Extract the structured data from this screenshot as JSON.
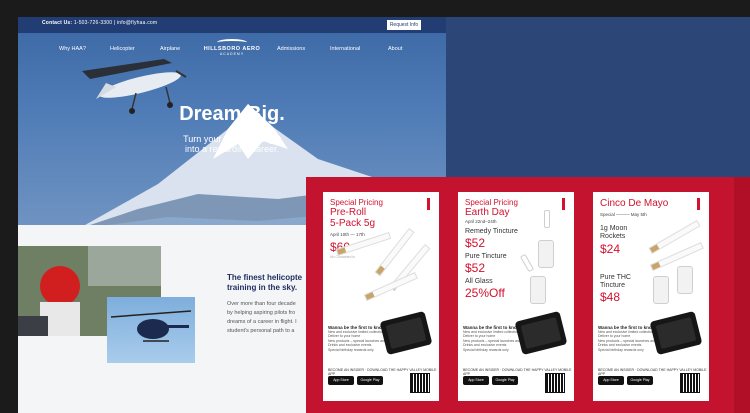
{
  "site": {
    "contact_label": "Contact Us:",
    "contact_text": "1-503-726-3300  |  info@flyhaa.com",
    "request_button": "Request Info",
    "nav": [
      "Why HAA?",
      "Helicopter",
      "Airplane",
      "Admissions",
      "International",
      "About"
    ],
    "logo_line1": "HILLSBORO AERO",
    "logo_line2": "ACADEMY",
    "headline": "Dream Big.",
    "subline1": "Turn your dream of flight",
    "subline2": "into a rewarding career.",
    "finest_line1": "The finest helicopte",
    "finest_line2": "training in the sky.",
    "body_lines": [
      "Over more than four decade",
      "by helping aspiring pilots fro",
      "dreams of a career in flight. I",
      "student's personal path to a"
    ]
  },
  "posters": [
    {
      "title1": "Special Pricing",
      "title2a": "Pre-Roll",
      "title2b": "5-Pack 5g",
      "date": "April 10th — 17th",
      "price": "$60",
      "price_note": "No.Contained in"
    },
    {
      "title1": "Special Pricing",
      "title2a": "Earth Day",
      "date": "April 22nd–24th",
      "item1": "Remedy Tincture",
      "price1": "$52",
      "item2": "Pure Tincture",
      "price2": "$52",
      "item3": "All Glass",
      "price3": "25%Off"
    },
    {
      "title2a": "Cinco De Mayo",
      "date": "Special ——— May 5th",
      "item1a": "1g Moon",
      "item1b": "Rockets",
      "price1": "$24",
      "item2a": "Pure THC",
      "item2b": "Tincture",
      "price2": "$48"
    }
  ],
  "poster_common": {
    "question": "Wanna be the first to know?",
    "bullets": [
      "New and exclusive limited collections",
      "Deliver to your home",
      "New products – special launches and OB release",
      "Drinks and exclusive events",
      "Special birthday rewards only"
    ],
    "become": "BECOME AN INSIDER · DOWNLOAD THE HAPPY VALLEY MOBILE APP",
    "appstore": "App Store",
    "googleplay": "Google Play"
  },
  "colors": {
    "navy": "#213d73",
    "poster_red": "#d2122e",
    "bg_red": "#c4132e",
    "bg_blue": "#2c4677"
  }
}
